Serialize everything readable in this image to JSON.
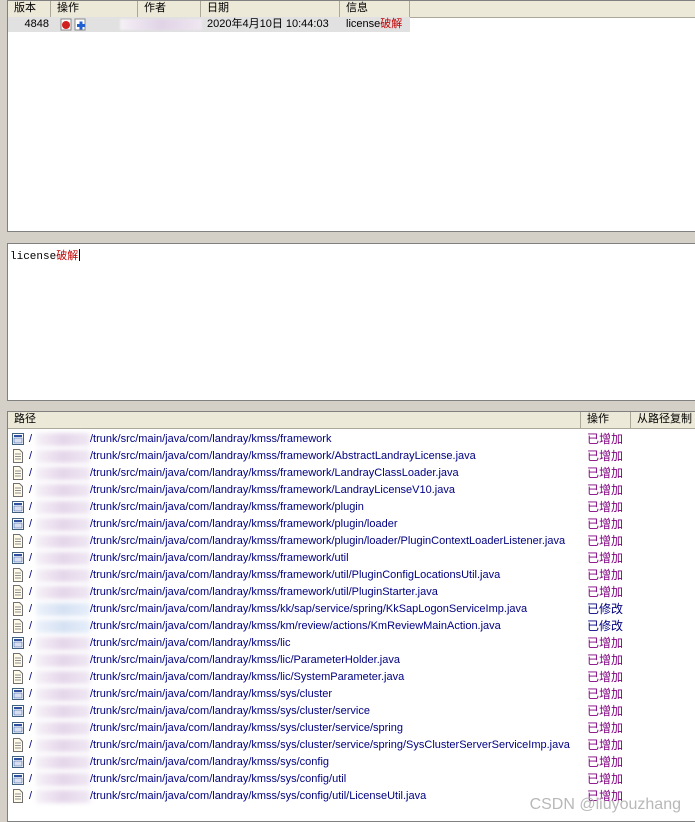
{
  "log_table": {
    "columns": [
      "版本",
      "操作",
      "作者",
      "日期",
      "信息"
    ],
    "rows": [
      {
        "revision": "4848",
        "date": "2020年4月10日 10:44:03",
        "message_prefix": "license",
        "message_suffix": "破解"
      }
    ]
  },
  "message_box": {
    "prefix": "license",
    "suffix": "破解"
  },
  "paths_table": {
    "columns": [
      "路径",
      "操作",
      "从路径复制"
    ],
    "rows": [
      {
        "icon": "folder-icon",
        "path": "/trunk/src/main/java/com/landray/kmss/framework",
        "action": "已增加",
        "kind": "add"
      },
      {
        "icon": "file-icon",
        "path": "/trunk/src/main/java/com/landray/kmss/framework/AbstractLandrayLicense.java",
        "action": "已增加",
        "kind": "add"
      },
      {
        "icon": "file-icon",
        "path": "/trunk/src/main/java/com/landray/kmss/framework/LandrayClassLoader.java",
        "action": "已增加",
        "kind": "add"
      },
      {
        "icon": "file-icon",
        "path": "/trunk/src/main/java/com/landray/kmss/framework/LandrayLicenseV10.java",
        "action": "已增加",
        "kind": "add"
      },
      {
        "icon": "folder-icon",
        "path": "/trunk/src/main/java/com/landray/kmss/framework/plugin",
        "action": "已增加",
        "kind": "add"
      },
      {
        "icon": "folder-icon",
        "path": "/trunk/src/main/java/com/landray/kmss/framework/plugin/loader",
        "action": "已增加",
        "kind": "add"
      },
      {
        "icon": "file-icon",
        "path": "/trunk/src/main/java/com/landray/kmss/framework/plugin/loader/PluginContextLoaderListener.java",
        "action": "已增加",
        "kind": "add"
      },
      {
        "icon": "folder-icon",
        "path": "/trunk/src/main/java/com/landray/kmss/framework/util",
        "action": "已增加",
        "kind": "add"
      },
      {
        "icon": "file-icon",
        "path": "/trunk/src/main/java/com/landray/kmss/framework/util/PluginConfigLocationsUtil.java",
        "action": "已增加",
        "kind": "add"
      },
      {
        "icon": "file-icon",
        "path": "/trunk/src/main/java/com/landray/kmss/framework/util/PluginStarter.java",
        "action": "已增加",
        "kind": "add"
      },
      {
        "icon": "file-icon",
        "path": "/trunk/src/main/java/com/landray/kmss/kk/sap/service/spring/KkSapLogonServiceImp.java",
        "action": "已修改",
        "kind": "mod"
      },
      {
        "icon": "file-icon",
        "path": "/trunk/src/main/java/com/landray/kmss/km/review/actions/KmReviewMainAction.java",
        "action": "已修改",
        "kind": "mod"
      },
      {
        "icon": "folder-icon",
        "path": "/trunk/src/main/java/com/landray/kmss/lic",
        "action": "已增加",
        "kind": "add"
      },
      {
        "icon": "file-icon",
        "path": "/trunk/src/main/java/com/landray/kmss/lic/ParameterHolder.java",
        "action": "已增加",
        "kind": "add"
      },
      {
        "icon": "file-icon",
        "path": "/trunk/src/main/java/com/landray/kmss/lic/SystemParameter.java",
        "action": "已增加",
        "kind": "add"
      },
      {
        "icon": "folder-icon",
        "path": "/trunk/src/main/java/com/landray/kmss/sys/cluster",
        "action": "已增加",
        "kind": "add"
      },
      {
        "icon": "folder-icon",
        "path": "/trunk/src/main/java/com/landray/kmss/sys/cluster/service",
        "action": "已增加",
        "kind": "add"
      },
      {
        "icon": "folder-icon",
        "path": "/trunk/src/main/java/com/landray/kmss/sys/cluster/service/spring",
        "action": "已增加",
        "kind": "add"
      },
      {
        "icon": "file-icon",
        "path": "/trunk/src/main/java/com/landray/kmss/sys/cluster/service/spring/SysClusterServerServiceImp.java",
        "action": "已增加",
        "kind": "add"
      },
      {
        "icon": "folder-icon",
        "path": "/trunk/src/main/java/com/landray/kmss/sys/config",
        "action": "已增加",
        "kind": "add"
      },
      {
        "icon": "folder-icon",
        "path": "/trunk/src/main/java/com/landray/kmss/sys/config/util",
        "action": "已增加",
        "kind": "add"
      },
      {
        "icon": "file-icon",
        "path": "/trunk/src/main/java/com/landray/kmss/sys/config/util/LicenseUtil.java",
        "action": "已增加",
        "kind": "add"
      }
    ]
  },
  "watermark": "CSDN @liuyouzhang"
}
